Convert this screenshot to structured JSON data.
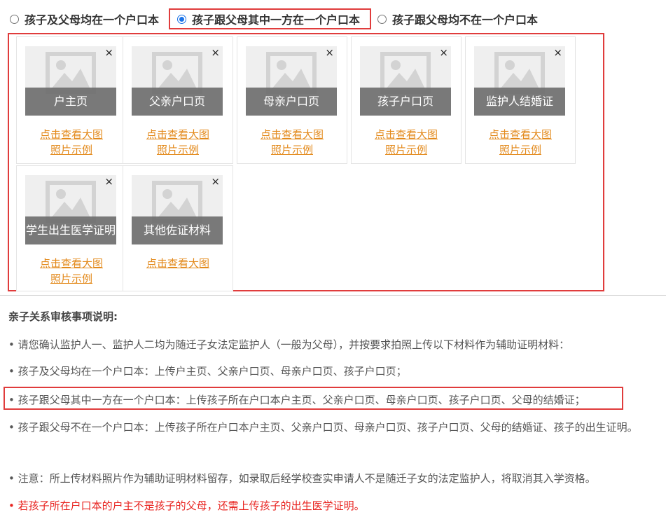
{
  "radio": {
    "options": [
      {
        "label": "孩子及父母均在一个户口本",
        "checked": false
      },
      {
        "label": "孩子跟父母其中一方在一个户口本",
        "checked": true
      },
      {
        "label": "孩子跟父母均不在一个户口本",
        "checked": false
      }
    ]
  },
  "upload": {
    "close_glyph": "×",
    "view_label": "点击查看大图",
    "example_label": "照片示例",
    "items": [
      {
        "caption": "户主页"
      },
      {
        "caption": "父亲户口页"
      },
      {
        "caption": "母亲户口页"
      },
      {
        "caption": "孩子户口页"
      },
      {
        "caption": "监护人结婚证"
      },
      {
        "caption": "学生出生医学证明"
      },
      {
        "caption": "其他佐证材料"
      }
    ]
  },
  "notes": {
    "title": "亲子关系审核事项说明:",
    "items": [
      "• 请您确认监护人一、监护人二均为随迁子女法定监护人（一般为父母），并按要求拍照上传以下材料作为辅助证明材料：",
      "• 孩子及父母均在一个户口本：上传户主页、父亲户口页、母亲户口页、孩子户口页；",
      "• 孩子跟父母其中一方在一个户口本：上传孩子所在户口本户主页、父亲户口页、母亲户口页、孩子户口页、父母的结婚证；",
      "• 孩子跟父母不在一个户口本：上传孩子所在户口本户主页、父亲户口页、母亲户口页、孩子户口页、父母的结婚证、孩子的出生证明。",
      "• 注意：所上传材料照片作为辅助证明材料留存，如录取后经学校查实申请人不是随迁子女的法定监护人，将取消其入学资格。",
      "• 若孩子所在户口本的户主不是孩子的父母，还需上传孩子的出生医学证明。"
    ]
  },
  "colors": {
    "highlight": "#e03c3c",
    "link": "#e38a1c",
    "warning": "#e8231f",
    "radio_checked": "#1a73e8"
  }
}
